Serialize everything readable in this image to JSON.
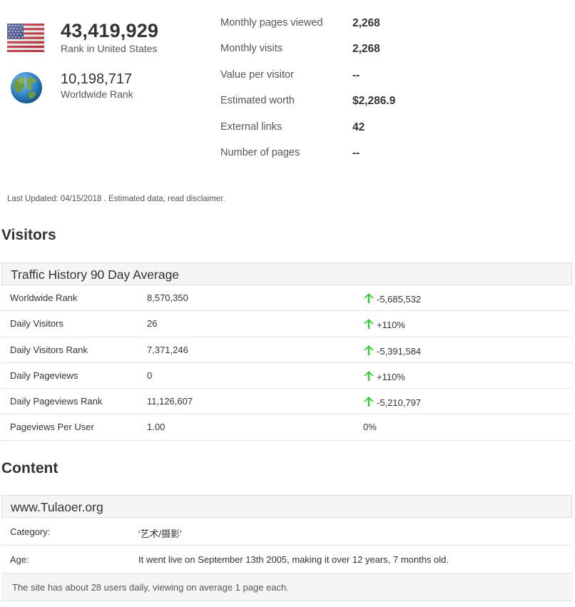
{
  "ranks": {
    "country": {
      "value": "43,419,929",
      "label": "Rank in United States"
    },
    "worldwide": {
      "value": "10,198,717",
      "label": "Worldwide Rank"
    }
  },
  "stats": [
    {
      "label": "Monthly pages viewed",
      "value": "2,268"
    },
    {
      "label": "Monthly visits",
      "value": "2,268"
    },
    {
      "label": "Value per visitor",
      "value": "--"
    },
    {
      "label": "Estimated worth",
      "value": "$2,286.9"
    },
    {
      "label": "External links",
      "value": "42"
    },
    {
      "label": "Number of pages",
      "value": "--"
    }
  ],
  "last_updated": "Last Updated: 04/15/2018 . Estimated data, read disclaimer.",
  "visitors": {
    "title": "Visitors",
    "table_title": "Traffic History 90 Day Average",
    "rows": [
      {
        "metric": "Worldwide Rank",
        "value": "8,570,350",
        "change": "-5,685,532",
        "trend_icon": "arrow-up-icon"
      },
      {
        "metric": "Daily Visitors",
        "value": "26",
        "change": "+110%",
        "trend_icon": "arrow-up-icon"
      },
      {
        "metric": "Daily Visitors Rank",
        "value": "7,371,246",
        "change": "-5,391,584",
        "trend_icon": "arrow-up-icon"
      },
      {
        "metric": "Daily Pageviews",
        "value": "0",
        "change": "+110%",
        "trend_icon": "arrow-up-icon"
      },
      {
        "metric": "Daily Pageviews Rank",
        "value": "11,126,607",
        "change": "-5,210,797",
        "trend_icon": "arrow-up-icon"
      },
      {
        "metric": "Pageviews Per User",
        "value": "1.00",
        "change": "0%",
        "trend_icon": ""
      }
    ]
  },
  "content": {
    "title": "Content",
    "site": "www.Tulaoer.org",
    "rows": [
      {
        "label": "Category:",
        "value": "'艺术/摄影'"
      },
      {
        "label": "Age:",
        "value": "It went live on September 13th 2005, making it over 12 years, 7 months old."
      }
    ],
    "note": "The site has about 28 users daily, viewing on average 1 page each."
  },
  "colors": {
    "trend_up": "#3cc73c",
    "header_bg": "#f5f5f5",
    "text": "#333333"
  }
}
